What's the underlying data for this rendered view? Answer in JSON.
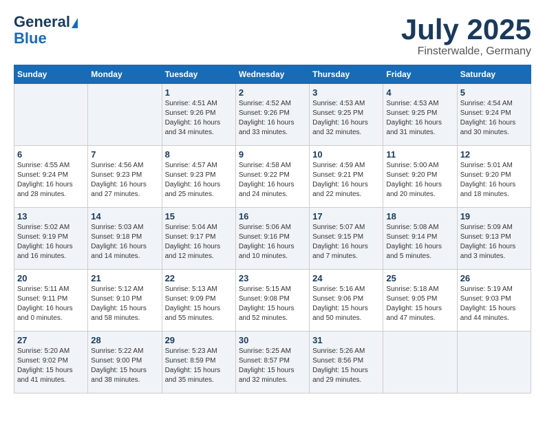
{
  "logo": {
    "line1": "General",
    "line2": "Blue"
  },
  "title": "July 2025",
  "location": "Finsterwalde, Germany",
  "weekdays": [
    "Sunday",
    "Monday",
    "Tuesday",
    "Wednesday",
    "Thursday",
    "Friday",
    "Saturday"
  ],
  "weeks": [
    [
      {
        "day": "",
        "info": ""
      },
      {
        "day": "",
        "info": ""
      },
      {
        "day": "1",
        "info": "Sunrise: 4:51 AM\nSunset: 9:26 PM\nDaylight: 16 hours\nand 34 minutes."
      },
      {
        "day": "2",
        "info": "Sunrise: 4:52 AM\nSunset: 9:26 PM\nDaylight: 16 hours\nand 33 minutes."
      },
      {
        "day": "3",
        "info": "Sunrise: 4:53 AM\nSunset: 9:25 PM\nDaylight: 16 hours\nand 32 minutes."
      },
      {
        "day": "4",
        "info": "Sunrise: 4:53 AM\nSunset: 9:25 PM\nDaylight: 16 hours\nand 31 minutes."
      },
      {
        "day": "5",
        "info": "Sunrise: 4:54 AM\nSunset: 9:24 PM\nDaylight: 16 hours\nand 30 minutes."
      }
    ],
    [
      {
        "day": "6",
        "info": "Sunrise: 4:55 AM\nSunset: 9:24 PM\nDaylight: 16 hours\nand 28 minutes."
      },
      {
        "day": "7",
        "info": "Sunrise: 4:56 AM\nSunset: 9:23 PM\nDaylight: 16 hours\nand 27 minutes."
      },
      {
        "day": "8",
        "info": "Sunrise: 4:57 AM\nSunset: 9:23 PM\nDaylight: 16 hours\nand 25 minutes."
      },
      {
        "day": "9",
        "info": "Sunrise: 4:58 AM\nSunset: 9:22 PM\nDaylight: 16 hours\nand 24 minutes."
      },
      {
        "day": "10",
        "info": "Sunrise: 4:59 AM\nSunset: 9:21 PM\nDaylight: 16 hours\nand 22 minutes."
      },
      {
        "day": "11",
        "info": "Sunrise: 5:00 AM\nSunset: 9:20 PM\nDaylight: 16 hours\nand 20 minutes."
      },
      {
        "day": "12",
        "info": "Sunrise: 5:01 AM\nSunset: 9:20 PM\nDaylight: 16 hours\nand 18 minutes."
      }
    ],
    [
      {
        "day": "13",
        "info": "Sunrise: 5:02 AM\nSunset: 9:19 PM\nDaylight: 16 hours\nand 16 minutes."
      },
      {
        "day": "14",
        "info": "Sunrise: 5:03 AM\nSunset: 9:18 PM\nDaylight: 16 hours\nand 14 minutes."
      },
      {
        "day": "15",
        "info": "Sunrise: 5:04 AM\nSunset: 9:17 PM\nDaylight: 16 hours\nand 12 minutes."
      },
      {
        "day": "16",
        "info": "Sunrise: 5:06 AM\nSunset: 9:16 PM\nDaylight: 16 hours\nand 10 minutes."
      },
      {
        "day": "17",
        "info": "Sunrise: 5:07 AM\nSunset: 9:15 PM\nDaylight: 16 hours\nand 7 minutes."
      },
      {
        "day": "18",
        "info": "Sunrise: 5:08 AM\nSunset: 9:14 PM\nDaylight: 16 hours\nand 5 minutes."
      },
      {
        "day": "19",
        "info": "Sunrise: 5:09 AM\nSunset: 9:13 PM\nDaylight: 16 hours\nand 3 minutes."
      }
    ],
    [
      {
        "day": "20",
        "info": "Sunrise: 5:11 AM\nSunset: 9:11 PM\nDaylight: 16 hours\nand 0 minutes."
      },
      {
        "day": "21",
        "info": "Sunrise: 5:12 AM\nSunset: 9:10 PM\nDaylight: 15 hours\nand 58 minutes."
      },
      {
        "day": "22",
        "info": "Sunrise: 5:13 AM\nSunset: 9:09 PM\nDaylight: 15 hours\nand 55 minutes."
      },
      {
        "day": "23",
        "info": "Sunrise: 5:15 AM\nSunset: 9:08 PM\nDaylight: 15 hours\nand 52 minutes."
      },
      {
        "day": "24",
        "info": "Sunrise: 5:16 AM\nSunset: 9:06 PM\nDaylight: 15 hours\nand 50 minutes."
      },
      {
        "day": "25",
        "info": "Sunrise: 5:18 AM\nSunset: 9:05 PM\nDaylight: 15 hours\nand 47 minutes."
      },
      {
        "day": "26",
        "info": "Sunrise: 5:19 AM\nSunset: 9:03 PM\nDaylight: 15 hours\nand 44 minutes."
      }
    ],
    [
      {
        "day": "27",
        "info": "Sunrise: 5:20 AM\nSunset: 9:02 PM\nDaylight: 15 hours\nand 41 minutes."
      },
      {
        "day": "28",
        "info": "Sunrise: 5:22 AM\nSunset: 9:00 PM\nDaylight: 15 hours\nand 38 minutes."
      },
      {
        "day": "29",
        "info": "Sunrise: 5:23 AM\nSunset: 8:59 PM\nDaylight: 15 hours\nand 35 minutes."
      },
      {
        "day": "30",
        "info": "Sunrise: 5:25 AM\nSunset: 8:57 PM\nDaylight: 15 hours\nand 32 minutes."
      },
      {
        "day": "31",
        "info": "Sunrise: 5:26 AM\nSunset: 8:56 PM\nDaylight: 15 hours\nand 29 minutes."
      },
      {
        "day": "",
        "info": ""
      },
      {
        "day": "",
        "info": ""
      }
    ]
  ]
}
